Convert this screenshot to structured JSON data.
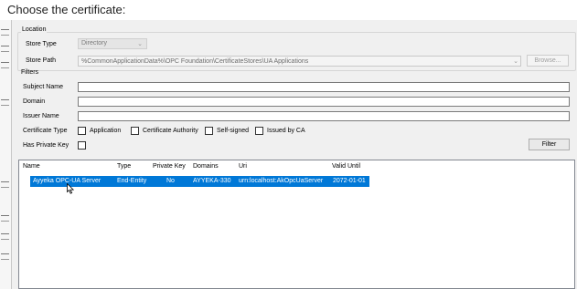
{
  "title": "Choose the certificate:",
  "location": {
    "group_label": "Location",
    "store_type_label": "Store Type",
    "store_type_value": "Directory",
    "store_path_label": "Store Path",
    "store_path_value": "%CommonApplicationData%\\OPC Foundation\\CertificateStores\\UA Applications",
    "browse_label": "Browse..."
  },
  "filters": {
    "group_label": "Filters",
    "subject_name_label": "Subject Name",
    "subject_name_value": "",
    "domain_label": "Domain",
    "domain_value": "",
    "issuer_name_label": "Issuer Name",
    "issuer_name_value": "",
    "certificate_type_label": "Certificate Type",
    "type_options": [
      "Application",
      "Certificate Authority",
      "Self-signed",
      "Issued by CA"
    ],
    "type_checked": [
      false,
      false,
      false,
      false
    ],
    "has_private_key_label": "Has Private Key",
    "has_private_key_checked": false,
    "filter_button_label": "Filter"
  },
  "list": {
    "columns": [
      "Name",
      "Type",
      "Private Key",
      "Domains",
      "Uri",
      "Valid Until"
    ],
    "rows": [
      {
        "selected": true,
        "cells": [
          "Ayyeka OPC-UA Server",
          "End-Entity",
          "No",
          "AYYEKA-330",
          "urn:localhost:AkOpcUaServer",
          "2072-01-01"
        ]
      }
    ]
  },
  "colors": {
    "selection": "#0078d7",
    "dialog_bg": "#f0f0f0"
  },
  "icons": {
    "dropdown": "chevron-down-icon",
    "cursor": "mouse-pointer-icon"
  }
}
